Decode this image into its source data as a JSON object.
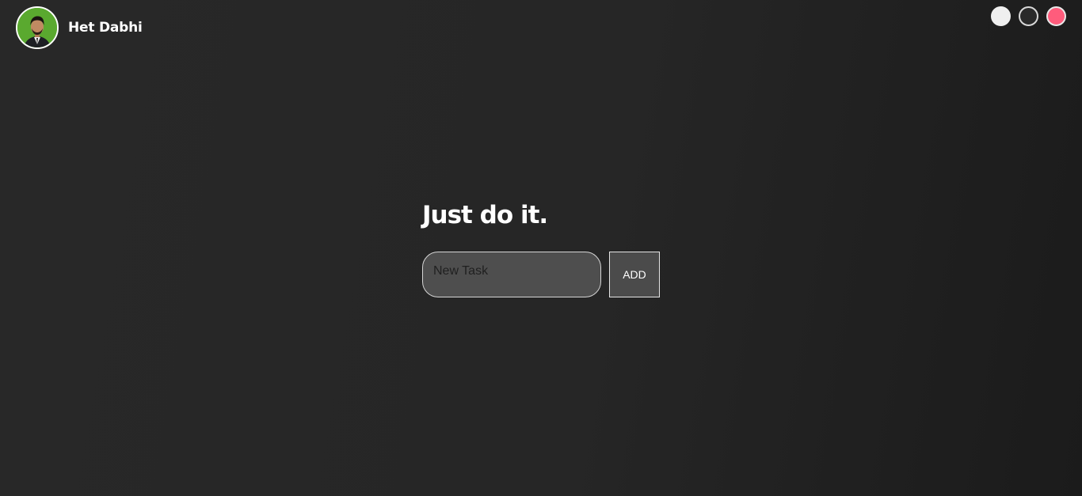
{
  "profile": {
    "name": "Het Dabhi",
    "avatar_icon": "person-photo-icon"
  },
  "theme_switcher": {
    "options": [
      {
        "name": "standard",
        "color": "#efefef"
      },
      {
        "name": "light",
        "color": "#2a2a2a"
      },
      {
        "name": "darker",
        "color": "#ff5c7c"
      }
    ]
  },
  "main": {
    "title": "Just do it.",
    "input_placeholder": "New Task",
    "input_value": "",
    "add_label": "ADD"
  },
  "colors": {
    "background": "#262626",
    "accent": "#ff5c7c",
    "input_bg": "#4e4e4e",
    "button_bg": "#4b4b4b"
  }
}
